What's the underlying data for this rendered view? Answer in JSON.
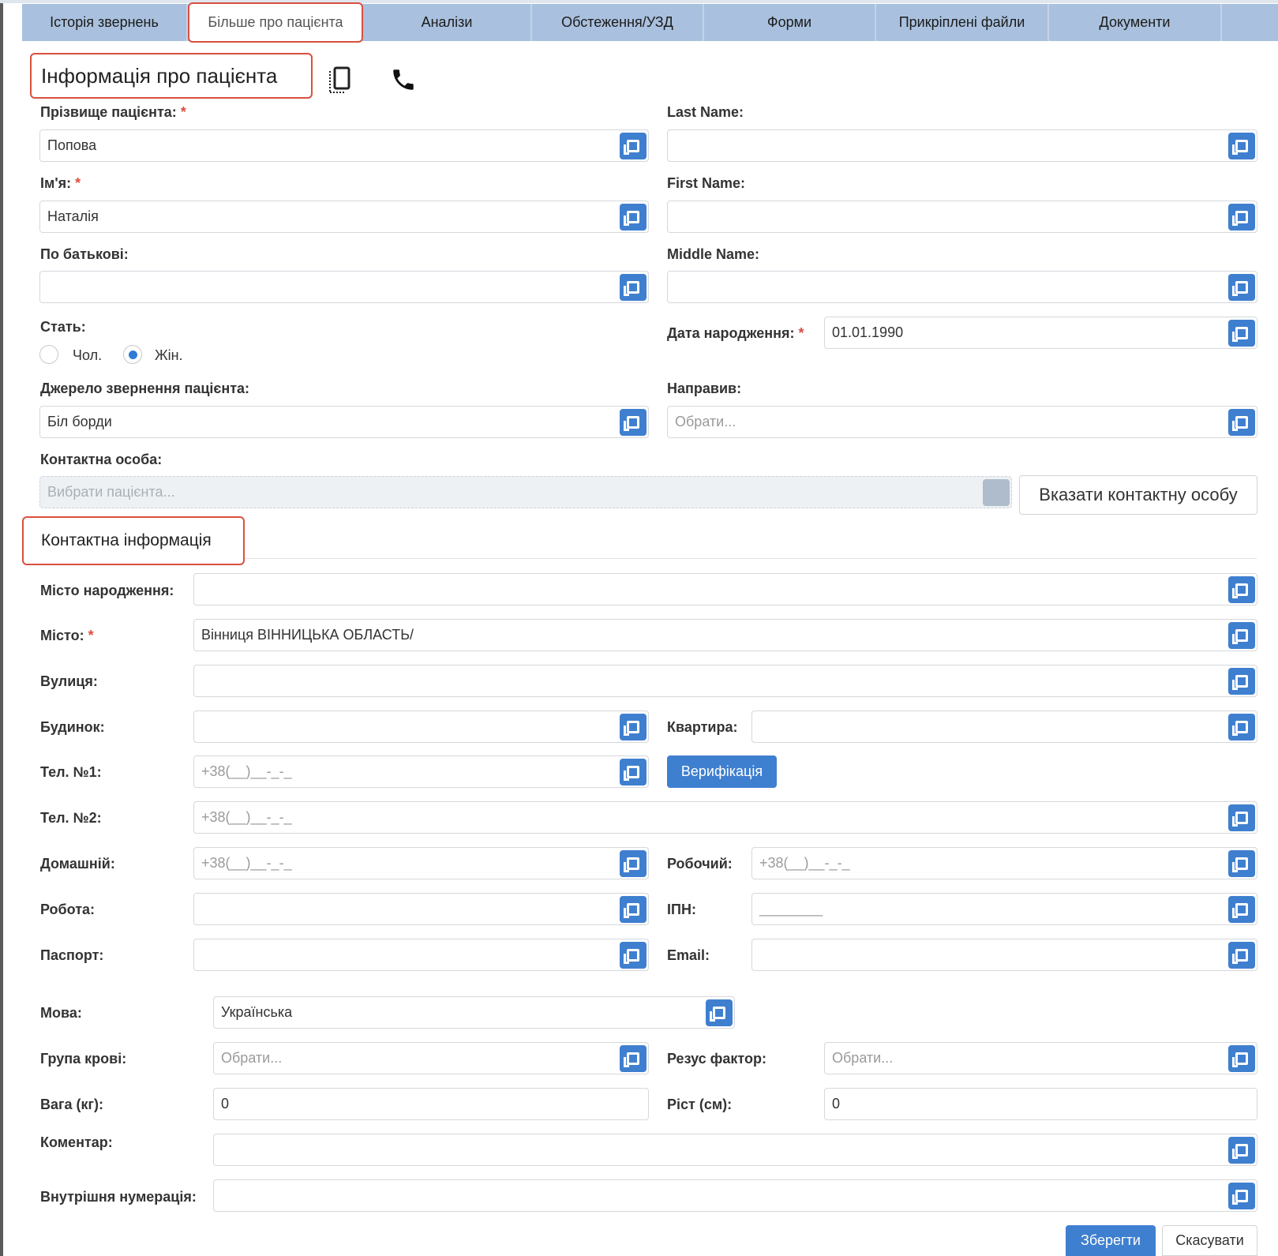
{
  "tabs": [
    {
      "label": "Історія звернень"
    },
    {
      "label": "Більше про пацієнта"
    },
    {
      "label": "Аналізи"
    },
    {
      "label": "Обстеження/УЗД"
    },
    {
      "label": "Форми"
    },
    {
      "label": "Прикріплені файли"
    },
    {
      "label": "Документи"
    }
  ],
  "section_patient": "Інформація про пацієнта",
  "section_contact": "Контактна інформація",
  "required_mark": "*",
  "fields": {
    "surname": {
      "label": "Прізвище пацієнта:",
      "value": "Попова"
    },
    "last_name": {
      "label": "Last Name:",
      "value": ""
    },
    "first_name_ua": {
      "label": "Ім'я:",
      "value": "Наталія"
    },
    "first_name": {
      "label": "First Name:",
      "value": ""
    },
    "patronymic": {
      "label": "По батькові:",
      "value": ""
    },
    "middle_name": {
      "label": "Middle Name:",
      "value": ""
    },
    "gender": {
      "label": "Стать:",
      "male": "Чол.",
      "female": "Жін.",
      "selected": "Жін."
    },
    "birth_date": {
      "label": "Дата народження:",
      "value": "01.01.1990"
    },
    "source": {
      "label": "Джерело звернення пацієнта:",
      "value": "Біл борди"
    },
    "referred_by": {
      "label": "Направив:",
      "placeholder": "Обрати..."
    },
    "contact_person": {
      "label": "Контактна особа:",
      "placeholder": "Вибрати пацієнта..."
    },
    "birth_city": {
      "label": "Місто народження:",
      "value": ""
    },
    "city": {
      "label": "Місто:",
      "value": "Вінниця  ВІННИЦЬКА ОБЛАСТЬ/"
    },
    "street": {
      "label": "Вулиця:",
      "value": ""
    },
    "house": {
      "label": "Будинок:",
      "value": ""
    },
    "apartment": {
      "label": "Квартира:",
      "value": ""
    },
    "phone1": {
      "label": "Тел. №1:",
      "placeholder": "+38(__)__-_-_"
    },
    "phone2": {
      "label": "Тел. №2:",
      "placeholder": "+38(__)__-_-_"
    },
    "home": {
      "label": "Домашній:",
      "placeholder": "+38(__)__-_-_"
    },
    "work_phone": {
      "label": "Робочий:",
      "placeholder": "+38(__)__-_-_"
    },
    "job": {
      "label": "Робота:",
      "value": ""
    },
    "ipn": {
      "label": "ІПН:",
      "placeholder": "________"
    },
    "passport": {
      "label": "Паспорт:",
      "value": ""
    },
    "email": {
      "label": "Email:",
      "value": ""
    },
    "language": {
      "label": "Мова:",
      "value": "Українська"
    },
    "blood_group": {
      "label": "Група крові:",
      "placeholder": "Обрати..."
    },
    "rh_factor": {
      "label": "Резус фактор:",
      "placeholder": "Обрати..."
    },
    "weight": {
      "label": "Вага (кг):",
      "value": "0"
    },
    "height": {
      "label": "Ріст (см):",
      "value": "0"
    },
    "comment": {
      "label": "Коментар:",
      "value": ""
    },
    "internal_number": {
      "label": "Внутрішня нумерація:",
      "value": ""
    }
  },
  "buttons": {
    "set_contact": "Вказати контактну особу",
    "verify": "Верифікація",
    "save": "Зберегти",
    "cancel": "Скасувати"
  },
  "colors": {
    "tab_bar": "#a9c1de",
    "accent": "#3f7fcf",
    "highlight": "#d9503f",
    "required": "#d9503f"
  }
}
